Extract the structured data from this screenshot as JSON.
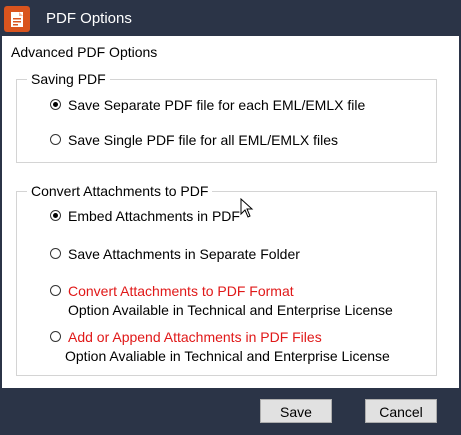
{
  "window": {
    "title": "PDF Options",
    "icon": "pdf-app-icon"
  },
  "heading": "Advanced PDF Options",
  "saving_group": {
    "legend": "Saving PDF",
    "options": [
      {
        "label": "Save Separate PDF file for each EML/EMLX file",
        "checked": true
      },
      {
        "label": "Save Single PDF file for all EML/EMLX files",
        "checked": false
      }
    ]
  },
  "attachments_group": {
    "legend": "Convert Attachments to PDF",
    "options": [
      {
        "label": "Embed Attachments in PDF",
        "checked": true
      },
      {
        "label": "Save Attachments in Separate Folder",
        "checked": false
      },
      {
        "label": "Convert Attachments to PDF Format",
        "checked": false,
        "note": "Option Available in Technical and Enterprise License"
      },
      {
        "label": "Add or Append Attachments in PDF Files",
        "checked": false,
        "note": "Option Avaliable in Technical and Enterprise License"
      }
    ]
  },
  "buttons": {
    "save": "Save",
    "cancel": "Cancel"
  },
  "colors": {
    "titlebar": "#2b3447",
    "licensed_option_text": "#e01818"
  }
}
